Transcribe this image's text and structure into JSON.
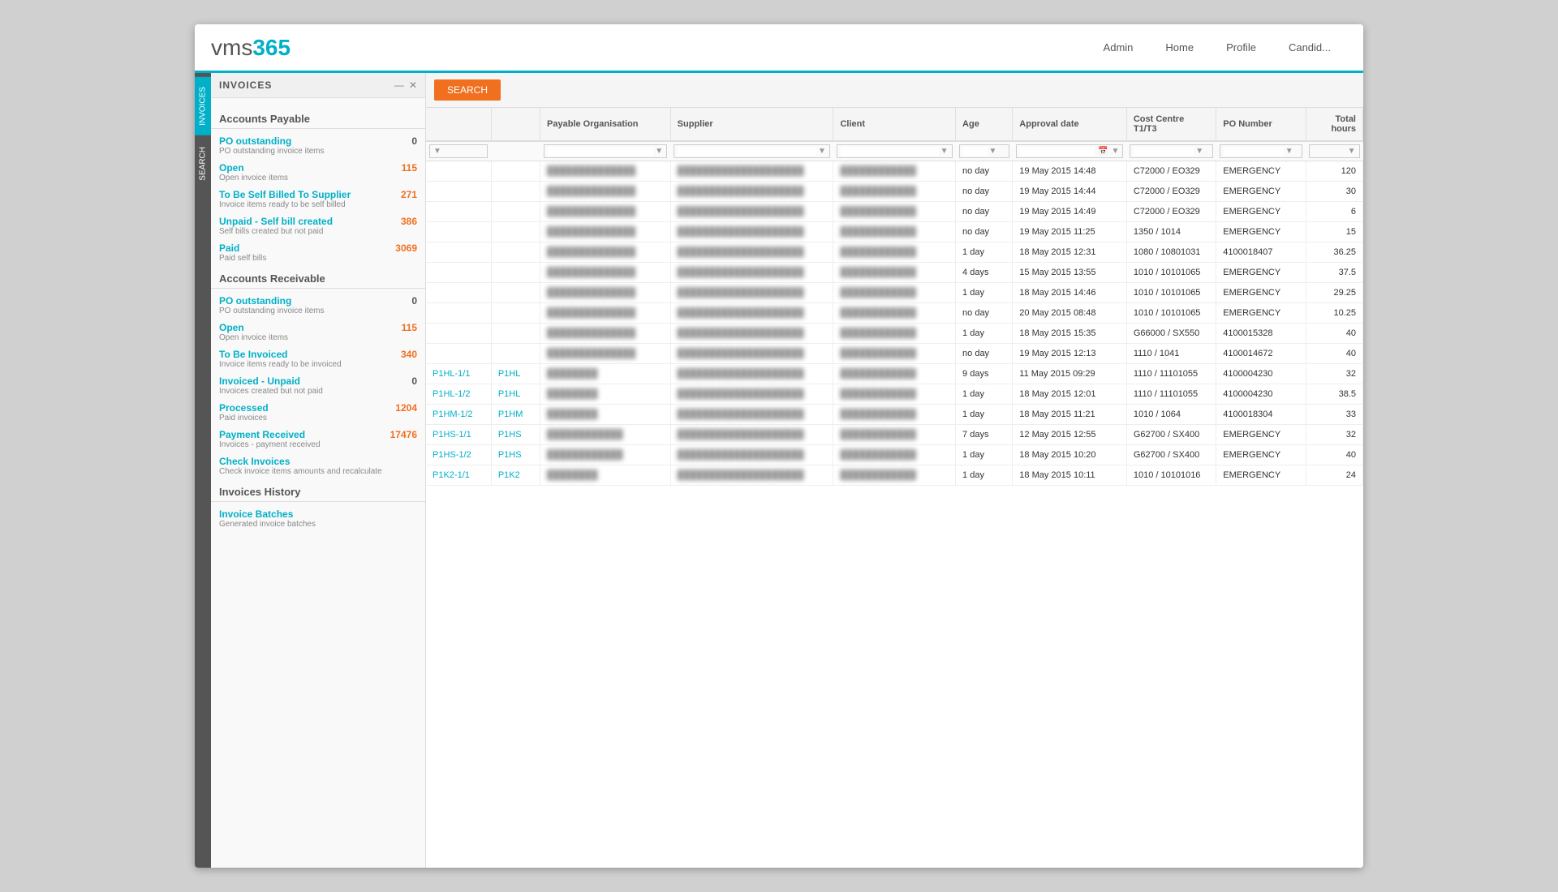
{
  "app": {
    "logo_text": "vms",
    "logo_accent": "365",
    "nav_links": [
      "Admin",
      "Home",
      "Profile",
      "Candid..."
    ]
  },
  "sidebar": {
    "tabs": [
      {
        "label": "INVOICES",
        "active": true
      },
      {
        "label": "SEARCH",
        "active": false
      }
    ],
    "panel_title": "INVOICES",
    "accounts_payable": {
      "section": "Accounts Payable",
      "items": [
        {
          "label": "PO outstanding",
          "desc": "PO outstanding invoice items",
          "count": "0",
          "count_color": "#555"
        },
        {
          "label": "Open",
          "desc": "Open invoice items",
          "count": "115",
          "count_color": "#f07020"
        },
        {
          "label": "To Be Self Billed To Supplier",
          "desc": "Invoice items ready to be self billed",
          "count": "271",
          "count_color": "#f07020"
        },
        {
          "label": "Unpaid - Self bill created",
          "desc": "Self bills created but not paid",
          "count": "386",
          "count_color": "#f07020"
        },
        {
          "label": "Paid",
          "desc": "Paid self bills",
          "count": "3069",
          "count_color": "#f07020"
        }
      ]
    },
    "accounts_receivable": {
      "section": "Accounts Receivable",
      "items": [
        {
          "label": "PO outstanding",
          "desc": "PO outstanding invoice items",
          "count": "0",
          "count_color": "#555"
        },
        {
          "label": "Open",
          "desc": "Open invoice items",
          "count": "115",
          "count_color": "#f07020"
        },
        {
          "label": "To Be Invoiced",
          "desc": "Invoice items ready to be invoiced",
          "count": "340",
          "count_color": "#f07020"
        },
        {
          "label": "Invoiced - Unpaid",
          "desc": "Invoices created but not paid",
          "count": "0",
          "count_color": "#555"
        },
        {
          "label": "Processed",
          "desc": "Paid invoices",
          "count": "1204",
          "count_color": "#f07020"
        },
        {
          "label": "Payment Received",
          "desc": "Invoices - payment received",
          "count": "17476",
          "count_color": "#f07020"
        },
        {
          "label": "Check Invoices",
          "desc": "Check invoice items amounts and recalculate",
          "count": "",
          "count_color": "#555"
        }
      ]
    },
    "invoices_history": {
      "section": "Invoices History",
      "items": [
        {
          "label": "Invoice Batches",
          "desc": "Generated invoice batches",
          "count": "",
          "count_color": "#555"
        }
      ]
    }
  },
  "table": {
    "search_btn": "SEARCH",
    "columns": [
      "",
      "Payable Organisation",
      "Supplier",
      "Client",
      "Age",
      "Approval date",
      "Cost Centre T1/T3",
      "PO Number",
      "Total hours"
    ],
    "rows": [
      {
        "id": "",
        "po": "",
        "payable_org": "██████████████",
        "supplier": "████████████████████",
        "client": "████████████",
        "age": "no day",
        "approval": "19 May 2015 14:48",
        "cost": "C72000 / EO329",
        "po_num": "EMERGENCY",
        "hours": "120"
      },
      {
        "id": "",
        "po": "",
        "payable_org": "██████████████",
        "supplier": "████████████████████",
        "client": "████████████",
        "age": "no day",
        "approval": "19 May 2015 14:44",
        "cost": "C72000 / EO329",
        "po_num": "EMERGENCY",
        "hours": "30"
      },
      {
        "id": "",
        "po": "",
        "payable_org": "██████████████",
        "supplier": "████████████████████",
        "client": "████████████",
        "age": "no day",
        "approval": "19 May 2015 14:49",
        "cost": "C72000 / EO329",
        "po_num": "EMERGENCY",
        "hours": "6"
      },
      {
        "id": "",
        "po": "",
        "payable_org": "██████████████",
        "supplier": "████████████████████",
        "client": "████████████",
        "age": "no day",
        "approval": "19 May 2015 11:25",
        "cost": "1350 / 1014",
        "po_num": "EMERGENCY",
        "hours": "15"
      },
      {
        "id": "",
        "po": "",
        "payable_org": "██████████████",
        "supplier": "████████████████████",
        "client": "████████████",
        "age": "1 day",
        "approval": "18 May 2015 12:31",
        "cost": "1080 / 10801031",
        "po_num": "4100018407",
        "hours": "36.25"
      },
      {
        "id": "",
        "po": "",
        "payable_org": "██████████████",
        "supplier": "████████████████████",
        "client": "████████████",
        "age": "4 days",
        "approval": "15 May 2015 13:55",
        "cost": "1010 / 10101065",
        "po_num": "EMERGENCY",
        "hours": "37.5"
      },
      {
        "id": "",
        "po": "",
        "payable_org": "██████████████",
        "supplier": "████████████████████",
        "client": "████████████",
        "age": "1 day",
        "approval": "18 May 2015 14:46",
        "cost": "1010 / 10101065",
        "po_num": "EMERGENCY",
        "hours": "29.25"
      },
      {
        "id": "",
        "po": "",
        "payable_org": "██████████████",
        "supplier": "████████████████████",
        "client": "████████████",
        "age": "no day",
        "approval": "20 May 2015 08:48",
        "cost": "1010 / 10101065",
        "po_num": "EMERGENCY",
        "hours": "10.25"
      },
      {
        "id": "",
        "po": "",
        "payable_org": "██████████████",
        "supplier": "████████████████████",
        "client": "████████████",
        "age": "1 day",
        "approval": "18 May 2015 15:35",
        "cost": "G66000 / SX550",
        "po_num": "4100015328",
        "hours": "40"
      },
      {
        "id": "",
        "po": "",
        "payable_org": "██████████████",
        "supplier": "████████████████████",
        "client": "████████████",
        "age": "no day",
        "approval": "19 May 2015 12:13",
        "cost": "1110 / 1041",
        "po_num": "4100014672",
        "hours": "40"
      },
      {
        "id": "P1HL-1/1",
        "po": "P1HL",
        "payable_org": "████████",
        "supplier": "████████████████████",
        "client": "████████████",
        "age": "9 days",
        "approval": "11 May 2015 09:29",
        "cost": "1110 / 11101055",
        "po_num": "4100004230",
        "hours": "32"
      },
      {
        "id": "P1HL-1/2",
        "po": "P1HL",
        "payable_org": "████████",
        "supplier": "████████████████████",
        "client": "████████████",
        "age": "1 day",
        "approval": "18 May 2015 12:01",
        "cost": "1110 / 11101055",
        "po_num": "4100004230",
        "hours": "38.5"
      },
      {
        "id": "P1HM-1/2",
        "po": "P1HM",
        "payable_org": "████████",
        "supplier": "████████████████████",
        "client": "████████████",
        "age": "1 day",
        "approval": "18 May 2015 11:21",
        "cost": "1010 / 1064",
        "po_num": "4100018304",
        "hours": "33"
      },
      {
        "id": "P1HS-1/1",
        "po": "P1HS",
        "payable_org": "████████████",
        "supplier": "████████████████████",
        "client": "████████████",
        "age": "7 days",
        "approval": "12 May 2015 12:55",
        "cost": "G62700 / SX400",
        "po_num": "EMERGENCY",
        "hours": "32"
      },
      {
        "id": "P1HS-1/2",
        "po": "P1HS",
        "payable_org": "████████████",
        "supplier": "████████████████████",
        "client": "████████████",
        "age": "1 day",
        "approval": "18 May 2015 10:20",
        "cost": "G62700 / SX400",
        "po_num": "EMERGENCY",
        "hours": "40"
      },
      {
        "id": "P1K2-1/1",
        "po": "P1K2",
        "payable_org": "████████",
        "supplier": "████████████████████",
        "client": "████████████",
        "age": "1 day",
        "approval": "18 May 2015 10:11",
        "cost": "1010 / 10101016",
        "po_num": "EMERGENCY",
        "hours": "24"
      }
    ]
  }
}
